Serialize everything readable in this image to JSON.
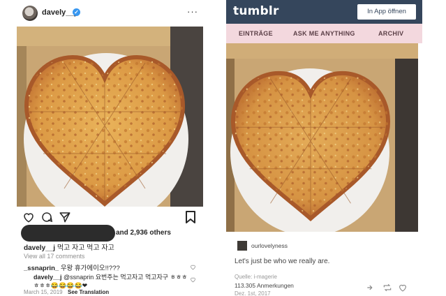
{
  "instagram": {
    "username": "davely__j",
    "likes_text": "and 2,936 others",
    "caption_user": "davely__j",
    "caption_text": "먹고 자고 먹고 자고",
    "view_all": "View all 17 comments",
    "comment1_user": "_ssnaprin_",
    "comment1_text": "우왕 휴가에이오!!???",
    "comment2_user": "davely__j",
    "comment2_text": "@ssnaprin 요번주는 먹고자고 먹고자구 ㅎㅎㅎ ㅎㅎㅎ😂😂😂😂❤",
    "date": "March 15, 2019",
    "translate": "See Translation"
  },
  "tumblr": {
    "logo": "tumblr",
    "app_button": "In App öffnen",
    "nav": [
      "EINTRÄGE",
      "ASK ME ANYTHING",
      "ARCHIV"
    ],
    "user": "ourlovelyness",
    "post_text": "Let's just be who we really are.",
    "source": "Quelle: i-magerie",
    "notes": "113.305 Anmerkungen",
    "date": "Dez. 1st, 2017"
  },
  "icons": {
    "ig": [
      "avatar",
      "verified-badge",
      "more-icon",
      "heart-icon",
      "comment-icon",
      "share-icon",
      "bookmark-icon"
    ],
    "tumblr": [
      "reblog-icon",
      "heart-icon"
    ]
  },
  "colors": {
    "tumblr_header": "#35465c",
    "tumblr_nav": "#f3d8de",
    "ig_verified": "#3897f0"
  }
}
